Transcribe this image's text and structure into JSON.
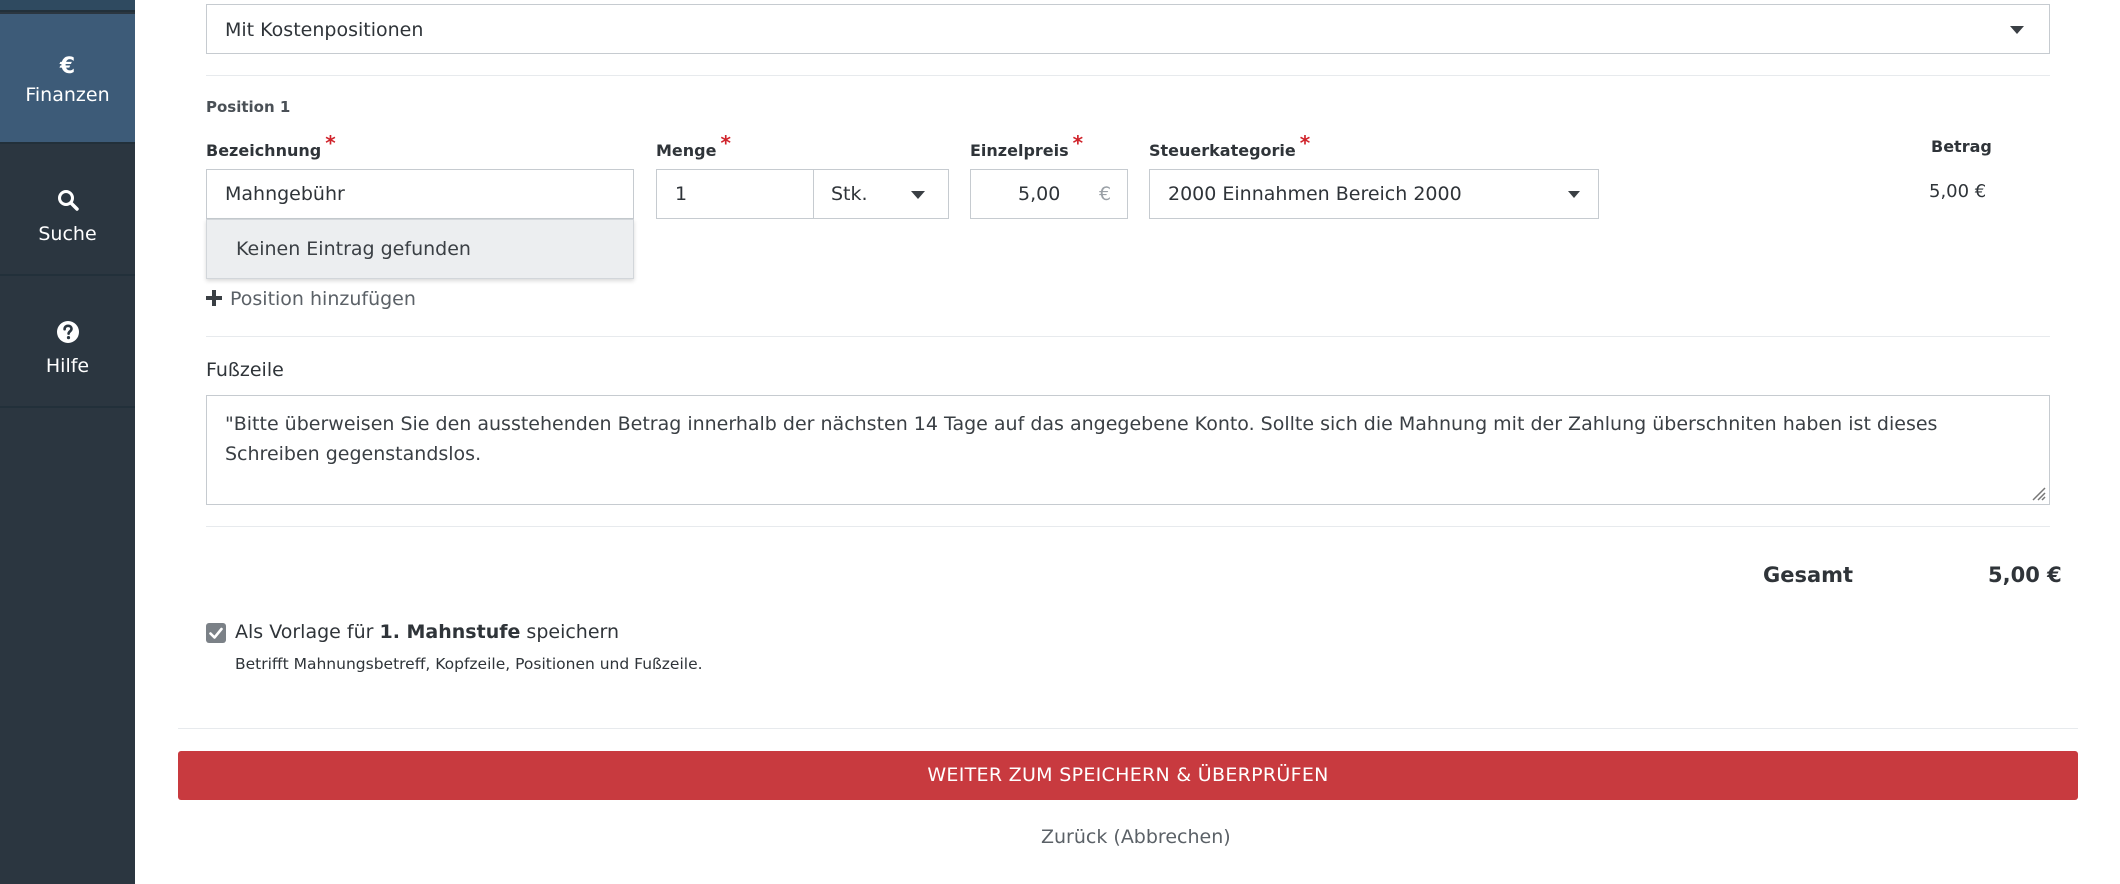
{
  "sidebar": {
    "items": [
      {
        "label": "Finanzen",
        "icon": "euro-icon",
        "glyph": "€"
      },
      {
        "label": "Suche",
        "icon": "search-icon"
      },
      {
        "label": "Hilfe",
        "icon": "help-circle-icon"
      }
    ]
  },
  "form": {
    "positions_select": "Mit Kostenpositionen",
    "position_title": "Position 1",
    "labels": {
      "bezeichnung": "Bezeichnung",
      "menge": "Menge",
      "einzelpreis": "Einzelpreis",
      "steuerkategorie": "Steuerkategorie",
      "betrag": "Betrag"
    },
    "required_marker": "*",
    "bezeichnung_value": "Mahngebühr",
    "autocomplete_message": "Keinen Eintrag gefunden",
    "menge_value": "1",
    "unit_value": "Stk.",
    "einzelpreis_value": "5,00",
    "currency_symbol": "€",
    "steuerkategorie_value": "2000 Einnahmen Bereich 2000",
    "betrag_value": "5,00 €",
    "add_position": "Position hinzufügen",
    "add_icon": "plus-icon",
    "footer_label": "Fußzeile",
    "footer_text": "\"Bitte überweisen Sie den ausstehenden Betrag innerhalb der nächsten 14 Tage auf das angegebene Konto. Sollte sich die Mahnung mit der Zahlung überschniten haben ist dieses Schreiben gegenstandslos.",
    "total_label": "Gesamt",
    "total_value": "5,00 €",
    "template_checkbox": {
      "checked": true,
      "prefix": "Als Vorlage für ",
      "bold": "1. Mahnstufe",
      "suffix": " speichern",
      "hint": "Betrifft Mahnungsbetreff, Kopfzeile, Positionen und Fußzeile."
    },
    "submit_label": "WEITER ZUM SPEICHERN & ÜBERPRÜFEN",
    "back_label": "Zurück (Abbrechen)"
  },
  "colors": {
    "sidebar_bg": "#2b3640",
    "sidebar_active": "#3d5b78",
    "required": "#d0232b",
    "primary_button": "#c83a3f"
  }
}
